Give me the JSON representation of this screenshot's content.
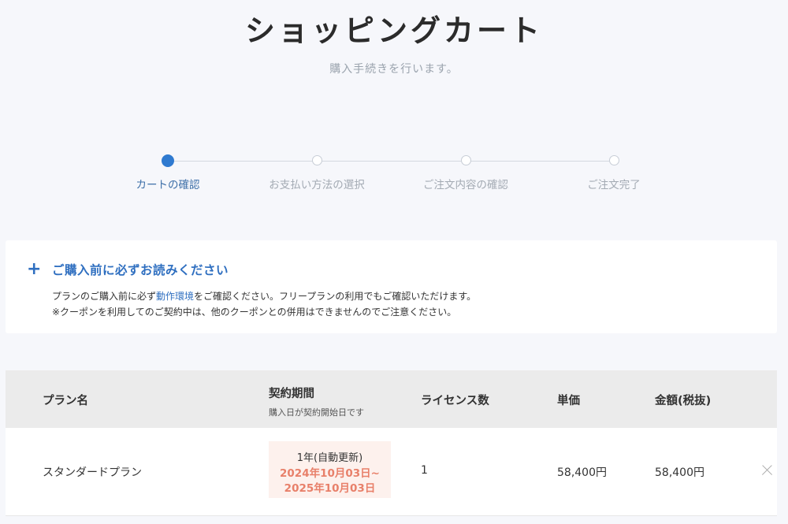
{
  "page": {
    "title": "ショッピングカート",
    "subtitle": "購入手続きを行います。"
  },
  "steps": [
    {
      "label": "カートの確認",
      "active": true
    },
    {
      "label": "お支払い方法の選択",
      "active": false
    },
    {
      "label": "ご注文内容の確認",
      "active": false
    },
    {
      "label": "ご注文完了",
      "active": false
    }
  ],
  "notice": {
    "heading": "ご購入前に必ずお読みください",
    "line1_before": "プランのご購入前に必ず",
    "line1_link": "動作環境",
    "line1_after": "をご確認ください。フリープランの利用でもご確認いただけます。",
    "line2": "※クーポンを利用してのご契約中は、他のクーポンとの併用はできませんのでご注意ください。",
    "accent_color": "#2f6fc0"
  },
  "table": {
    "headers": {
      "plan": "プラン名",
      "period": "契約期間",
      "period_note": "購入日が契約開始日です",
      "licenses": "ライセンス数",
      "unit_price": "単価",
      "amount": "金額(税抜)"
    },
    "rows": [
      {
        "plan": "スタンダードプラン",
        "cycle": "1年(自動更新)",
        "start": "2024年10月03日~",
        "end": "2025年10月03日",
        "licenses": "1",
        "unit_price": "58,400円",
        "amount": "58,400円"
      }
    ]
  }
}
